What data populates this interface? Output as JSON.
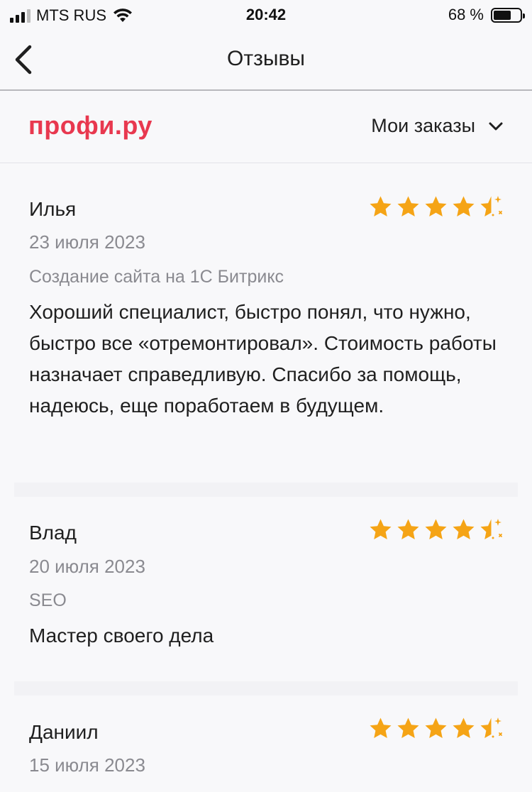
{
  "status_bar": {
    "carrier": "MTS RUS",
    "time": "20:42",
    "battery_percent": "68 %",
    "battery_level": 0.68
  },
  "nav": {
    "title": "Отзывы"
  },
  "brand": {
    "logo_text": "профи.ру",
    "orders_label": "Мои заказы"
  },
  "colors": {
    "brand_red": "#e8384f",
    "star_orange": "#f5a416"
  },
  "reviews": [
    {
      "name": "Илья",
      "date": "23 июля 2023",
      "service": "Создание сайта на 1С Битрикс",
      "text": "Хороший специалист, быстро понял, что нужно, быстро все «отремонтировал». Стоимость работы назначает справедливую. Спасибо за помощь, надеюсь, еще поработаем в будущем.",
      "rating": 4.5
    },
    {
      "name": "Влад",
      "date": "20 июля 2023",
      "service": "SEO",
      "text": "Мастер своего дела",
      "rating": 4.5
    },
    {
      "name": "Даниил",
      "date": "15 июля 2023",
      "service": "",
      "text": "",
      "rating": 4.5
    }
  ]
}
